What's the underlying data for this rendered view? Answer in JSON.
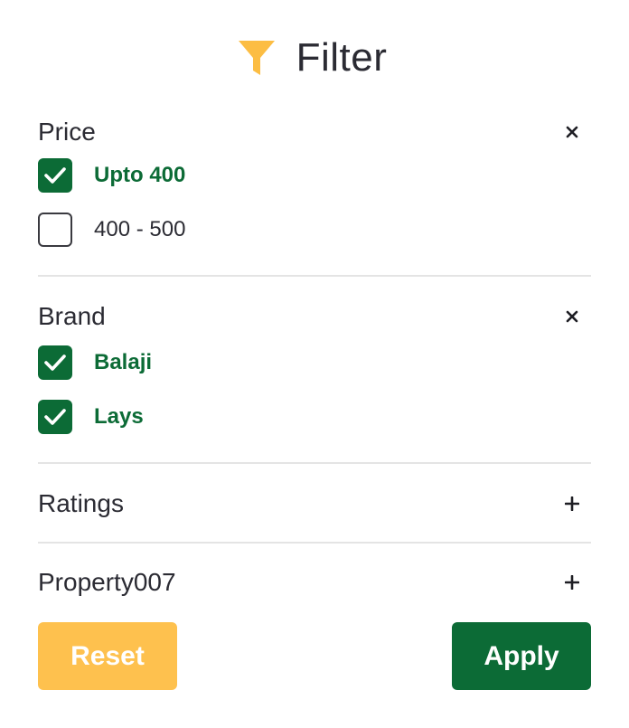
{
  "header": {
    "title": "Filter",
    "icon": "funnel-icon",
    "icon_color": "#fcbd43"
  },
  "sections": {
    "price": {
      "title": "Price",
      "toggle_icon": "close-icon",
      "expanded": true,
      "options": [
        {
          "label": "Upto 400",
          "checked": true
        },
        {
          "label": "400 - 500",
          "checked": false
        }
      ]
    },
    "brand": {
      "title": "Brand",
      "toggle_icon": "close-icon",
      "expanded": true,
      "options": [
        {
          "label": "Balaji",
          "checked": true
        },
        {
          "label": "Lays",
          "checked": true
        }
      ]
    },
    "ratings": {
      "title": "Ratings",
      "toggle_icon": "plus-icon",
      "expanded": false
    },
    "property": {
      "title": "Property007",
      "toggle_icon": "plus-icon",
      "expanded": false
    }
  },
  "buttons": {
    "reset_label": "Reset",
    "apply_label": "Apply"
  },
  "colors": {
    "accent_green": "#0c6b36",
    "accent_yellow": "#fec14e",
    "text": "#2b2b33",
    "divider": "#e4e4e4"
  }
}
